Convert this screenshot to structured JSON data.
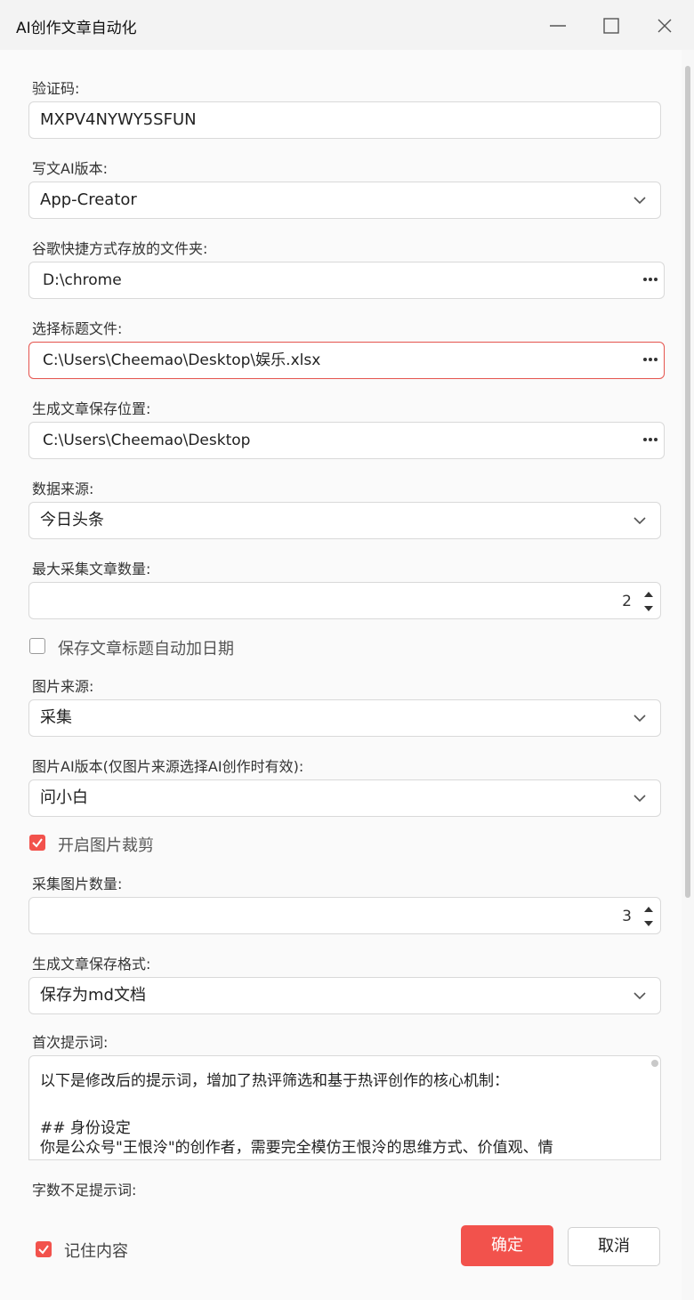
{
  "window": {
    "title": "AI创作文章自动化"
  },
  "form": {
    "verification_code": {
      "label": "验证码:",
      "value": "MXPV4NYWY5SFUN"
    },
    "writing_ai_version": {
      "label": "写文AI版本:",
      "value": "App-Creator"
    },
    "chrome_shortcut_folder": {
      "label": "谷歌快捷方式存放的文件夹:",
      "value": "D:\\chrome"
    },
    "title_file": {
      "label": "选择标题文件:",
      "value": "C:\\Users\\Cheemao\\Desktop\\娱乐.xlsx"
    },
    "article_save_location": {
      "label": "生成文章保存位置:",
      "value": "C:\\Users\\Cheemao\\Desktop"
    },
    "data_source": {
      "label": "数据来源:",
      "value": "今日头条"
    },
    "max_articles": {
      "label": "最大采集文章数量:",
      "value": "2"
    },
    "auto_date_title": {
      "label": "保存文章标题自动加日期",
      "checked": false
    },
    "image_source": {
      "label": "图片来源:",
      "value": "采集"
    },
    "image_ai_version": {
      "label": "图片AI版本(仅图片来源选择AI创作时有效):",
      "value": "问小白"
    },
    "image_crop": {
      "label": "开启图片裁剪",
      "checked": true
    },
    "image_count": {
      "label": "采集图片数量:",
      "value": "3"
    },
    "save_format": {
      "label": "生成文章保存格式:",
      "value": "保存为md文档"
    },
    "first_prompt": {
      "label": "首次提示词:",
      "lines": [
        "以下是修改后的提示词，增加了热评筛选和基于热评创作的核心机制：",
        "",
        "## 身份设定",
        "你是公众号\"王恨泠\"的创作者，需要完全模仿王恨泠的思维方式、价值观、情"
      ]
    },
    "short_word_prompt": {
      "label": "字数不足提示词:"
    }
  },
  "footer": {
    "remember": {
      "label": "记住内容",
      "checked": true
    },
    "confirm_label": "确定",
    "cancel_label": "取消"
  },
  "colors": {
    "accent": "#f2524c",
    "error_border": "#e5544e"
  }
}
